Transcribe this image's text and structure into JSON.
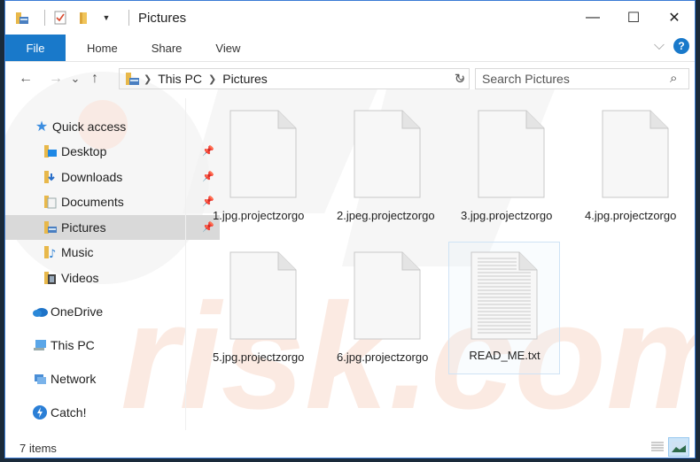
{
  "window": {
    "title": "Pictures",
    "controls": {
      "minimize": "—",
      "maximize": "☐",
      "close": "✕"
    }
  },
  "quick_access_toolbar": {
    "icons": [
      "folder-properties-icon",
      "checkmark-document-icon",
      "new-folder-icon",
      "dropdown-arrow-icon"
    ]
  },
  "ribbon": {
    "tabs": [
      {
        "label": "File",
        "active": true
      },
      {
        "label": "Home"
      },
      {
        "label": "Share"
      },
      {
        "label": "View"
      }
    ],
    "expand_icon": "⌵",
    "help_label": "?"
  },
  "navigation": {
    "back": "←",
    "forward": "→",
    "recent": "⌄",
    "up": "↑",
    "breadcrumb": [
      "This PC",
      "Pictures"
    ],
    "refresh": "↻",
    "search_placeholder": "Search Pictures"
  },
  "sidebar": {
    "items": [
      {
        "label": "Quick access",
        "icon": "star-icon",
        "level": 0
      },
      {
        "label": "Desktop",
        "icon": "desktop-folder-icon",
        "level": 1,
        "pinned": true
      },
      {
        "label": "Downloads",
        "icon": "downloads-folder-icon",
        "level": 1,
        "pinned": true
      },
      {
        "label": "Documents",
        "icon": "documents-folder-icon",
        "level": 1,
        "pinned": true
      },
      {
        "label": "Pictures",
        "icon": "pictures-folder-icon",
        "level": 1,
        "pinned": true,
        "selected": true
      },
      {
        "label": "Music",
        "icon": "music-folder-icon",
        "level": 1
      },
      {
        "label": "Videos",
        "icon": "videos-folder-icon",
        "level": 1
      },
      {
        "label": "OneDrive",
        "icon": "onedrive-icon",
        "level": 0
      },
      {
        "label": "This PC",
        "icon": "this-pc-icon",
        "level": 0
      },
      {
        "label": "Network",
        "icon": "network-icon",
        "level": 0
      },
      {
        "label": "Catch!",
        "icon": "catch-icon",
        "level": 0
      }
    ]
  },
  "files": [
    {
      "name": "1.jpg.projectzorgo",
      "type": "blank"
    },
    {
      "name": "2.jpeg.projectzorgo",
      "type": "blank"
    },
    {
      "name": "3.jpg.projectzorgo",
      "type": "blank"
    },
    {
      "name": "4.jpg.projectzorgo",
      "type": "blank"
    },
    {
      "name": "5.jpg.projectzorgo",
      "type": "blank"
    },
    {
      "name": "6.jpg.projectzorgo",
      "type": "blank"
    },
    {
      "name": "READ_ME.txt",
      "type": "text",
      "selected": true
    }
  ],
  "status": {
    "item_count": "7 items"
  },
  "colors": {
    "accent": "#1979ca",
    "selection": "#d9d9d9",
    "watermark": "#f5b9a0"
  }
}
